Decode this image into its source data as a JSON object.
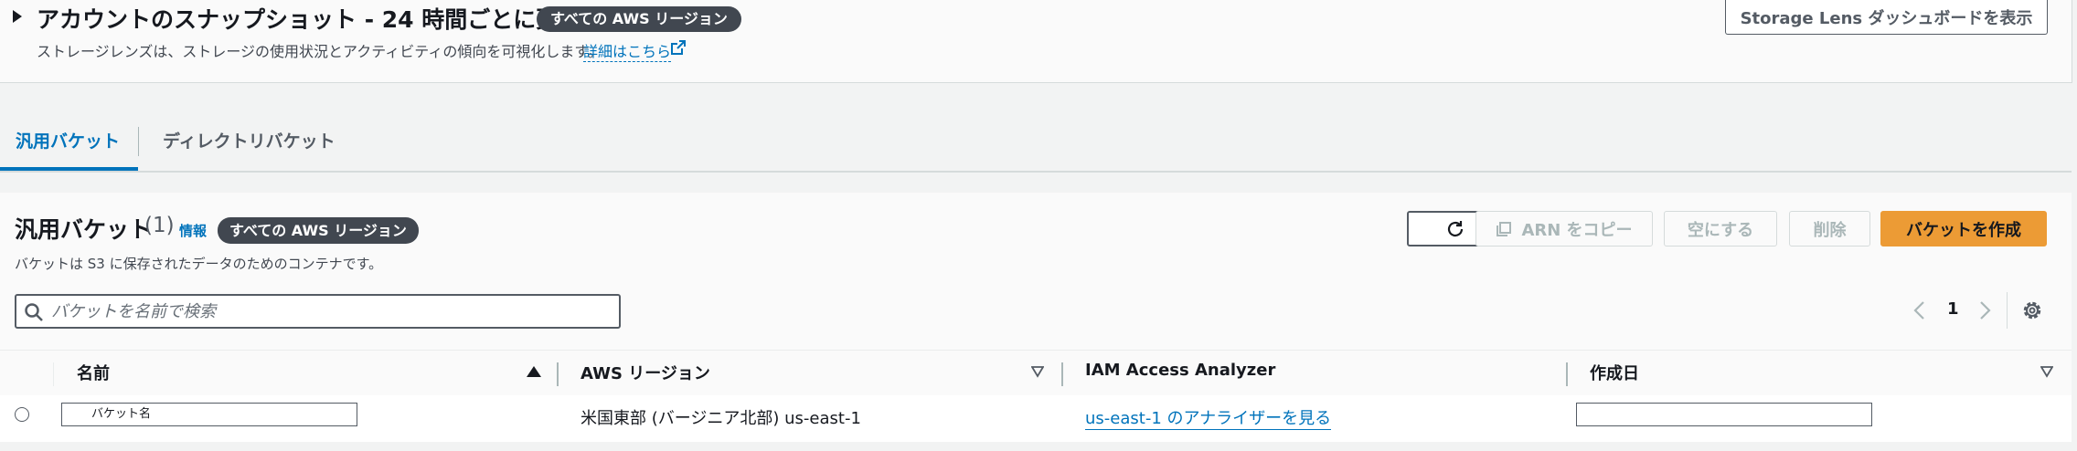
{
  "snapshot": {
    "title": "アカウントのスナップショット - 24 時間ごとに更新",
    "region_badge": "すべての AWS リージョン",
    "description": "ストレージレンズは、ストレージの使用状況とアクティビティの傾向を可視化します。",
    "learn_more": "詳細はこちら",
    "dashboard_button": "Storage Lens ダッシュボードを表示"
  },
  "tabs": [
    {
      "label": "汎用バケット",
      "active": true
    },
    {
      "label": "ディレクトリバケット",
      "active": false
    }
  ],
  "buckets": {
    "title": "汎用バケット",
    "count": "(1)",
    "info": "情報",
    "region_badge": "すべての AWS リージョン",
    "description": "バケットは S3 に保存されたデータのためのコンテナです。",
    "buttons": {
      "copy_arn": "ARN をコピー",
      "empty": "空にする",
      "delete": "削除",
      "create": "バケットを作成"
    },
    "search": {
      "placeholder": "バケットを名前で検索",
      "value": ""
    },
    "pagination": {
      "current_page": "1"
    },
    "columns": [
      "名前",
      "AWS リージョン",
      "IAM Access Analyzer",
      "作成日"
    ],
    "rows": [
      {
        "name": "バケット名",
        "region": "米国東部 (バージニア北部) us-east-1",
        "iam_link": "us-east-1 のアナライザーを見る",
        "created": ""
      }
    ]
  },
  "colors": {
    "accent": "#0073bb",
    "primary_button": "#ec9b35",
    "badge": "#414750",
    "disabled": "#aab7b8"
  },
  "icons": [
    "external-link-icon",
    "refresh-icon",
    "copy-icon",
    "search-icon",
    "chevron-left-icon",
    "chevron-right-icon",
    "settings-icon",
    "sort-ascending-icon",
    "sort-descending-icon"
  ]
}
